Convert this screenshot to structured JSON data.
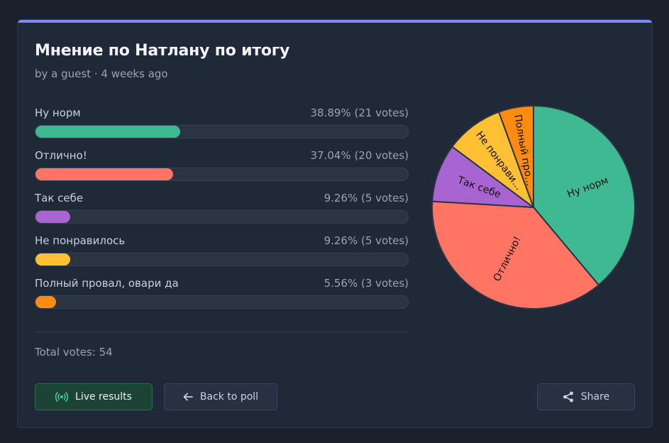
{
  "poll": {
    "title": "Мнение по Натлану по итогу",
    "meta": "by a guest · 4 weeks ago",
    "total": "Total votes: 54"
  },
  "options": [
    {
      "label": "Ну норм",
      "pct_text": "38.89% (21 votes)",
      "votes": 21,
      "percent": 38.89,
      "color": "#3fb991",
      "pie_label": "Ну норм"
    },
    {
      "label": "Отлично!",
      "pct_text": "37.04% (20 votes)",
      "votes": 20,
      "percent": 37.04,
      "color": "#ff7463",
      "pie_label": "Отлично!"
    },
    {
      "label": "Так себе",
      "pct_text": "9.26% (5 votes)",
      "votes": 5,
      "percent": 9.26,
      "color": "#a864d0",
      "pie_label": "Так себе"
    },
    {
      "label": "Не понравилось",
      "pct_text": "9.26% (5 votes)",
      "votes": 5,
      "percent": 9.26,
      "color": "#ffc034",
      "pie_label": "Не понрави..."
    },
    {
      "label": "Полный провал, овари да",
      "pct_text": "5.56% (3 votes)",
      "votes": 3,
      "percent": 5.56,
      "color": "#ff8b0f",
      "pie_label": "Полный про..."
    }
  ],
  "buttons": {
    "live": "Live results",
    "back": "Back to poll",
    "share": "Share"
  },
  "icons": {
    "live": "broadcast-icon",
    "back": "arrow-left-icon",
    "share": "share-icon"
  },
  "colors": {
    "accent_bar": "#7e88f4",
    "card_bg": "#202938",
    "page_bg": "#1a212d"
  },
  "chart_data": {
    "type": "pie",
    "categories": [
      "Ну норм",
      "Отлично!",
      "Так себе",
      "Не понрави...",
      "Полный про..."
    ],
    "values": [
      21,
      20,
      5,
      5,
      3
    ],
    "colors": [
      "#3fb991",
      "#ff7463",
      "#a864d0",
      "#ffc034",
      "#ff8b0f"
    ]
  }
}
